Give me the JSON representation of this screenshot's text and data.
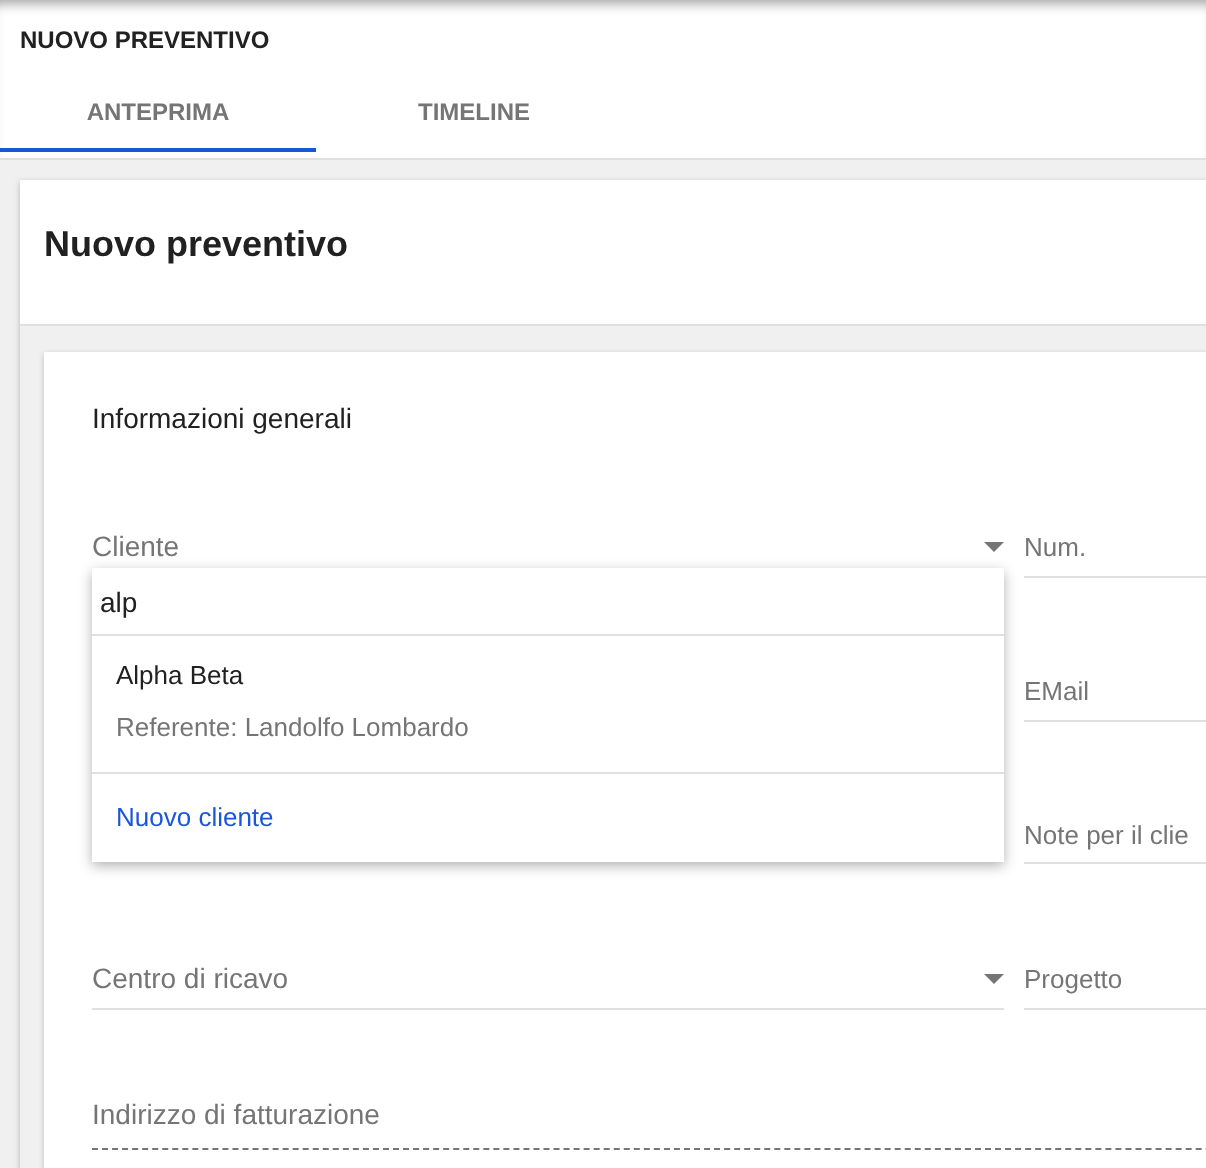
{
  "header": {
    "title": "NUOVO PREVENTIVO"
  },
  "tabs": [
    {
      "label": "ANTEPRIMA",
      "selected": true
    },
    {
      "label": "TIMELINE",
      "selected": false
    }
  ],
  "card": {
    "title": "Nuovo preventivo"
  },
  "section": {
    "title": "Informazioni generali"
  },
  "rows": [
    {
      "left": {
        "label": "Cliente",
        "kind": "select"
      },
      "right": {
        "label": "Num."
      }
    },
    {
      "right": {
        "label": "EMail"
      }
    },
    {
      "right": {
        "label": "Note per il clie"
      }
    },
    {
      "left": {
        "label": "Centro di ricavo",
        "kind": "select"
      },
      "right": {
        "label": "Progetto"
      }
    }
  ],
  "billing": {
    "label": "Indirizzo di fatturazione"
  },
  "dropdown": {
    "query": "alp",
    "options": [
      {
        "name": "Alpha Beta",
        "detail": "Referente: Landolfo Lombardo"
      }
    ],
    "action": "Nuovo cliente"
  }
}
